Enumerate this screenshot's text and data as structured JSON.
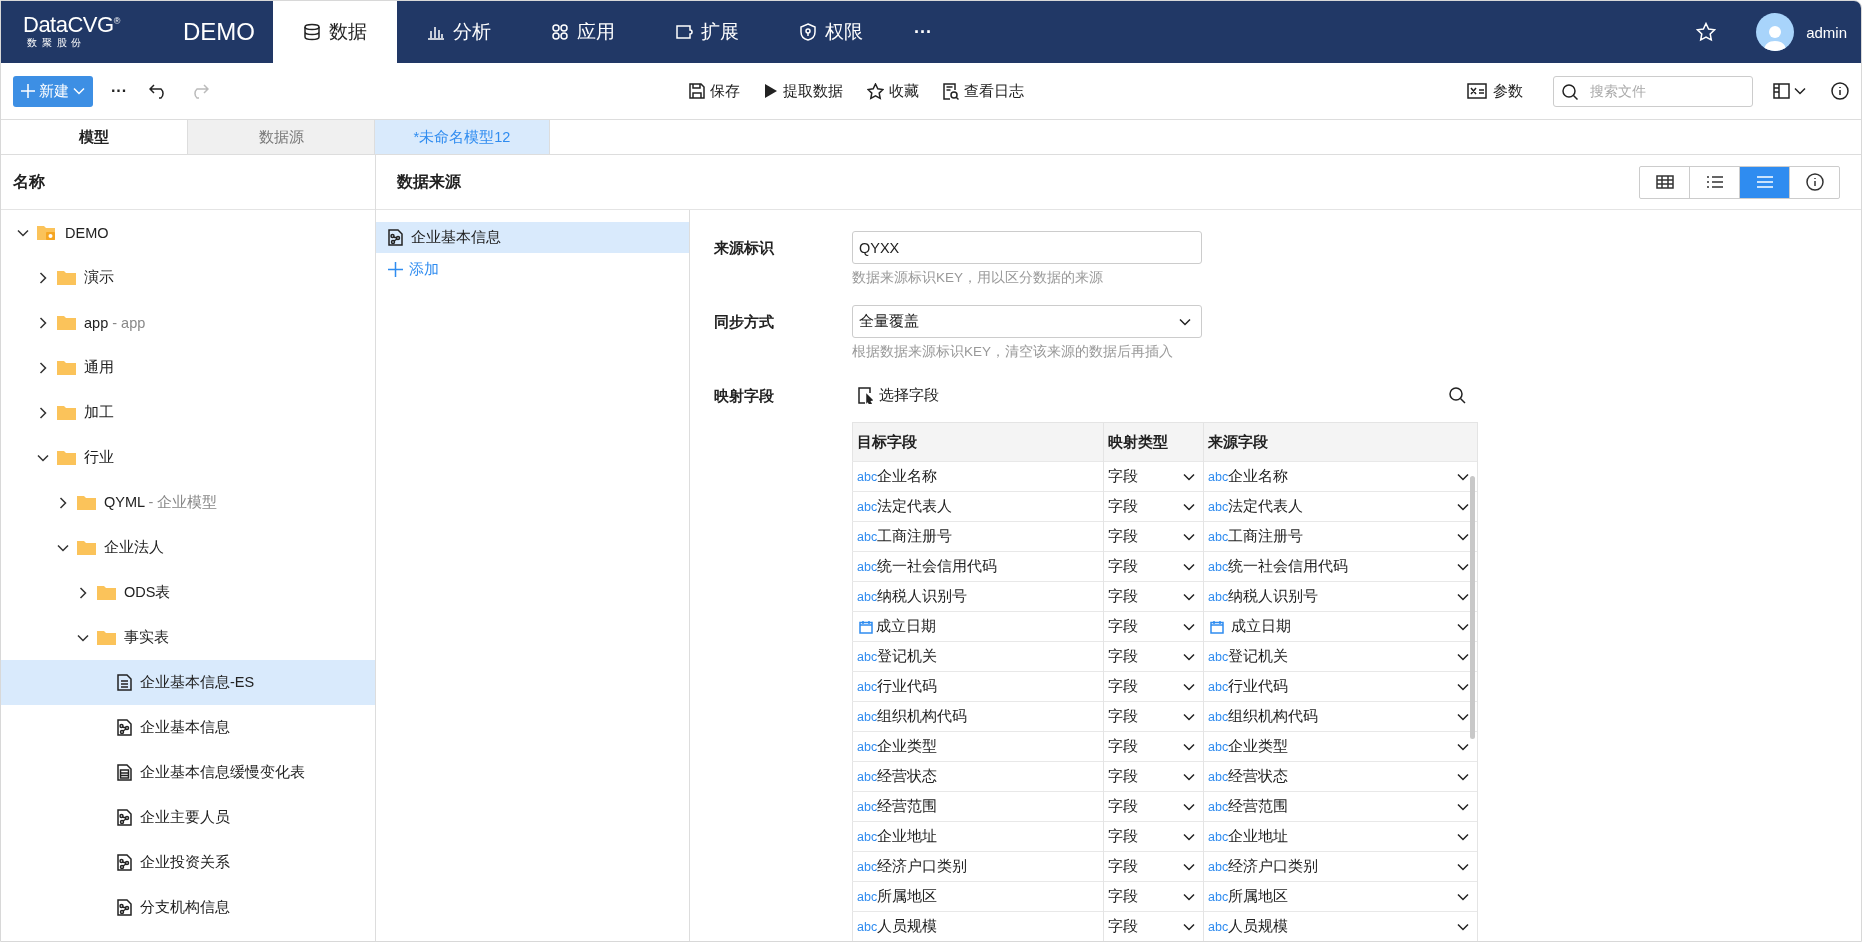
{
  "header": {
    "logo": {
      "name": "DataCVG",
      "mark": "®",
      "tagline": "数 聚 股 份"
    },
    "app_name": "DEMO",
    "nav": [
      {
        "label": "数据",
        "kind": "database",
        "selected": true
      },
      {
        "label": "分析",
        "kind": "chart",
        "selected": false
      },
      {
        "label": "应用",
        "kind": "apps",
        "selected": false
      },
      {
        "label": "扩展",
        "kind": "plugin",
        "selected": false
      },
      {
        "label": "权限",
        "kind": "shield",
        "selected": false
      }
    ],
    "more": "···",
    "user": "admin"
  },
  "toolbar": {
    "new_button": "新建",
    "more": "···",
    "actions": [
      {
        "label": "保存",
        "kind": "save"
      },
      {
        "label": "提取数据",
        "kind": "extract"
      },
      {
        "label": "收藏",
        "kind": "star"
      },
      {
        "label": "查看日志",
        "kind": "log"
      }
    ],
    "params": "参数",
    "search": {
      "placeholder": "搜索文件"
    }
  },
  "panel_tabs": [
    {
      "label": "模型",
      "selected": true
    },
    {
      "label": "数据源",
      "selected": false
    }
  ],
  "doc_tabs": [
    {
      "label": "*未命名模型12",
      "selected": true
    }
  ],
  "tree": {
    "header": "名称",
    "items": [
      {
        "label": "DEMO",
        "kind": "root",
        "expanded": true,
        "selected": false,
        "children": [
          {
            "label": "演示",
            "kind": "folder",
            "expanded": false,
            "selected": false
          },
          {
            "label": "app",
            "sublabel": "- app",
            "kind": "folder",
            "expanded": false,
            "selected": false
          },
          {
            "label": "通用",
            "kind": "folder",
            "expanded": false,
            "selected": false
          },
          {
            "label": "加工",
            "kind": "folder",
            "expanded": false,
            "selected": false
          },
          {
            "label": "行业",
            "kind": "folder",
            "expanded": true,
            "selected": false,
            "children": [
              {
                "label": "QYML",
                "sublabel": "- 企业模型",
                "kind": "folder",
                "expanded": false,
                "selected": false
              },
              {
                "label": "企业法人",
                "kind": "folder",
                "expanded": true,
                "selected": false,
                "children": [
                  {
                    "label": "ODS表",
                    "kind": "folder",
                    "expanded": false,
                    "selected": false
                  },
                  {
                    "label": "事实表",
                    "kind": "folder",
                    "expanded": true,
                    "selected": false,
                    "children": [
                      {
                        "label": "企业基本信息-ES",
                        "kind": "es",
                        "selected": true
                      },
                      {
                        "label": "企业基本信息",
                        "kind": "model",
                        "selected": false
                      },
                      {
                        "label": "企业基本信息缓慢变化表",
                        "kind": "table",
                        "selected": false
                      },
                      {
                        "label": "企业主要人员",
                        "kind": "model",
                        "selected": false
                      },
                      {
                        "label": "企业投资关系",
                        "kind": "model",
                        "selected": false
                      },
                      {
                        "label": "分支机构信息",
                        "kind": "model",
                        "selected": false
                      }
                    ]
                  }
                ]
              }
            ]
          }
        ]
      }
    ]
  },
  "sources": {
    "header": "数据来源",
    "items": [
      {
        "label": "企业基本信息",
        "selected": true
      }
    ],
    "add": "添加"
  },
  "view_modes": [
    {
      "kind": "grid",
      "selected": false
    },
    {
      "kind": "list",
      "selected": false
    },
    {
      "kind": "lines",
      "selected": true
    },
    {
      "kind": "info",
      "selected": false
    }
  ],
  "form": {
    "source_key": {
      "label": "来源标识",
      "value": "QYXX",
      "hint": "数据来源标识KEY，用以区分数据的来源"
    },
    "sync": {
      "label": "同步方式",
      "value": "全量覆盖",
      "hint": "根据数据来源标识KEY，清空该来源的数据后再插入"
    },
    "mapping": {
      "label": "映射字段",
      "select_button": "选择字段",
      "columns": [
        "目标字段",
        "映射类型",
        "来源字段"
      ],
      "rows": [
        {
          "kind": "text",
          "type_label": "abc",
          "target": "企业名称",
          "mapping": "字段",
          "source_type_label": "abc",
          "source": "企业名称"
        },
        {
          "kind": "text",
          "type_label": "abc",
          "target": "法定代表人",
          "mapping": "字段",
          "source_type_label": "abc",
          "source": "法定代表人"
        },
        {
          "kind": "text",
          "type_label": "abc",
          "target": "工商注册号",
          "mapping": "字段",
          "source_type_label": "abc",
          "source": "工商注册号"
        },
        {
          "kind": "text",
          "type_label": "abc",
          "target": "统一社会信用代码",
          "mapping": "字段",
          "source_type_label": "abc",
          "source": "统一社会信用代码"
        },
        {
          "kind": "text",
          "type_label": "abc",
          "target": "纳税人识别号",
          "mapping": "字段",
          "source_type_label": "abc",
          "source": "纳税人识别号"
        },
        {
          "kind": "date",
          "target": "成立日期",
          "mapping": "字段",
          "source": "成立日期"
        },
        {
          "kind": "text",
          "type_label": "abc",
          "target": "登记机关",
          "mapping": "字段",
          "source_type_label": "abc",
          "source": "登记机关"
        },
        {
          "kind": "text",
          "type_label": "abc",
          "target": "行业代码",
          "mapping": "字段",
          "source_type_label": "abc",
          "source": "行业代码"
        },
        {
          "kind": "text",
          "type_label": "abc",
          "target": "组织机构代码",
          "mapping": "字段",
          "source_type_label": "abc",
          "source": "组织机构代码"
        },
        {
          "kind": "text",
          "type_label": "abc",
          "target": "企业类型",
          "mapping": "字段",
          "source_type_label": "abc",
          "source": "企业类型"
        },
        {
          "kind": "text",
          "type_label": "abc",
          "target": "经营状态",
          "mapping": "字段",
          "source_type_label": "abc",
          "source": "经营状态"
        },
        {
          "kind": "text",
          "type_label": "abc",
          "target": "经营范围",
          "mapping": "字段",
          "source_type_label": "abc",
          "source": "经营范围"
        },
        {
          "kind": "text",
          "type_label": "abc",
          "target": "企业地址",
          "mapping": "字段",
          "source_type_label": "abc",
          "source": "企业地址"
        },
        {
          "kind": "text",
          "type_label": "abc",
          "target": "经济户口类别",
          "mapping": "字段",
          "source_type_label": "abc",
          "source": "经济户口类别"
        },
        {
          "kind": "text",
          "type_label": "abc",
          "target": "所属地区",
          "mapping": "字段",
          "source_type_label": "abc",
          "source": "所属地区"
        },
        {
          "kind": "text",
          "type_label": "abc",
          "target": "人员规模",
          "mapping": "字段",
          "source_type_label": "abc",
          "source": "人员规模"
        }
      ]
    }
  }
}
